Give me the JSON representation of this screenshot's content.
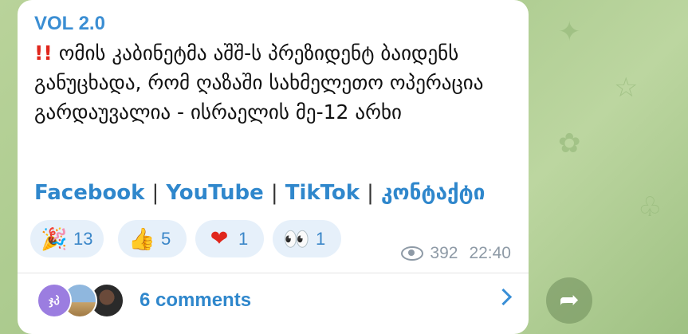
{
  "post": {
    "channel": "VOL 2.0",
    "bang_icon": "!!",
    "message": "ომის კაბინეტმა აშშ-ს პრეზიდენტ ბაიდენს განუცხადა, რომ ღაზაში სახმელეთო ოპერაცია გარდაუვალია - ისრაელის მე-12 არხი",
    "links": [
      "Facebook",
      "YouTube",
      "TikTok",
      "კონტაქტი"
    ],
    "link_separator": "|",
    "reactions": [
      {
        "emoji": "🎉",
        "icon": "party-popper-icon",
        "count": "13"
      },
      {
        "emoji": "👍",
        "icon": "thumbs-up-icon",
        "count": "5"
      },
      {
        "emoji": "❤",
        "icon": "heart-icon",
        "count": "1"
      },
      {
        "emoji": "👀",
        "icon": "eyes-icon",
        "count": "1"
      }
    ],
    "views": "392",
    "time": "22:40"
  },
  "comments": {
    "avatar_initials": "ჯპ",
    "label": "6 comments"
  },
  "colors": {
    "accent": "#2f87cc",
    "reaction_bg": "#e6f0fa",
    "bubble_bg": "#ffffff"
  }
}
